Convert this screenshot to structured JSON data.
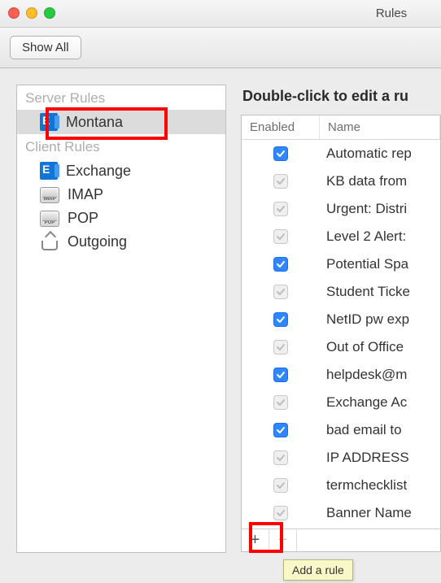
{
  "window": {
    "title": "Rules"
  },
  "toolbar": {
    "show_all": "Show All"
  },
  "sidebar": {
    "server_header": "Server Rules",
    "client_header": "Client Rules",
    "server_items": [
      {
        "label": "Montana"
      }
    ],
    "client_items": [
      {
        "label": "Exchange"
      },
      {
        "label": "IMAP"
      },
      {
        "label": "POP"
      },
      {
        "label": "Outgoing"
      }
    ]
  },
  "right": {
    "heading": "Double-click to edit a ru",
    "columns": {
      "enabled": "Enabled",
      "name": "Name"
    },
    "rules": [
      {
        "enabled": true,
        "name": "Automatic rep"
      },
      {
        "enabled": false,
        "name": "KB data from"
      },
      {
        "enabled": false,
        "name": "Urgent: Distri"
      },
      {
        "enabled": false,
        "name": "Level 2 Alert:"
      },
      {
        "enabled": true,
        "name": "Potential Spa"
      },
      {
        "enabled": false,
        "name": "Student Ticke"
      },
      {
        "enabled": true,
        "name": "NetID pw exp"
      },
      {
        "enabled": false,
        "name": "Out of Office"
      },
      {
        "enabled": true,
        "name": "helpdesk@m"
      },
      {
        "enabled": false,
        "name": "Exchange Ac"
      },
      {
        "enabled": true,
        "name": "bad email to"
      },
      {
        "enabled": false,
        "name": "IP ADDRESS"
      },
      {
        "enabled": false,
        "name": "termchecklist"
      },
      {
        "enabled": false,
        "name": "Banner Name"
      }
    ],
    "footer": {
      "add": "+",
      "remove": "−"
    },
    "tooltip": "Add a rule"
  }
}
